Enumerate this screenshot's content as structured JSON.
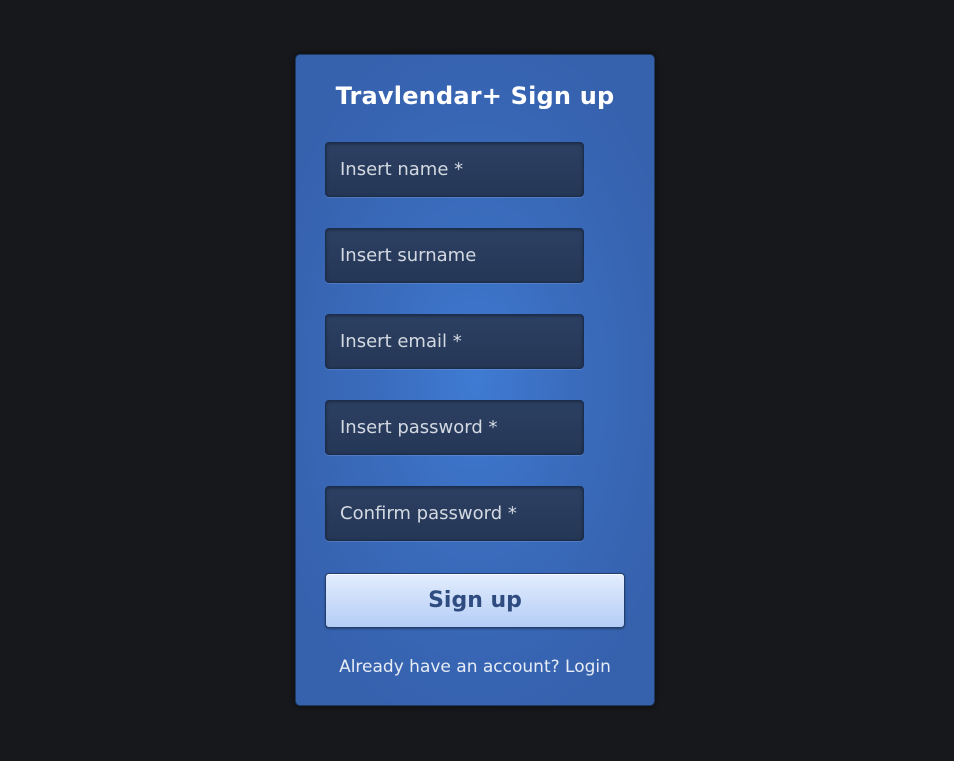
{
  "form": {
    "title": "Travlendar+ Sign up",
    "fields": [
      {
        "placeholder": "Insert name *"
      },
      {
        "placeholder": "Insert surname"
      },
      {
        "placeholder": "Insert email *"
      },
      {
        "placeholder": "Insert password *"
      },
      {
        "placeholder": "Confirm password *"
      }
    ],
    "submit_label": "Sign up",
    "footer_text": "Already have an account?",
    "login_link": "Login"
  },
  "colors": {
    "background": "#17181c",
    "card": "#3a6cbd",
    "field": "#283b5c",
    "button": "#c9dcfa",
    "button_text": "#2e4c7f"
  }
}
